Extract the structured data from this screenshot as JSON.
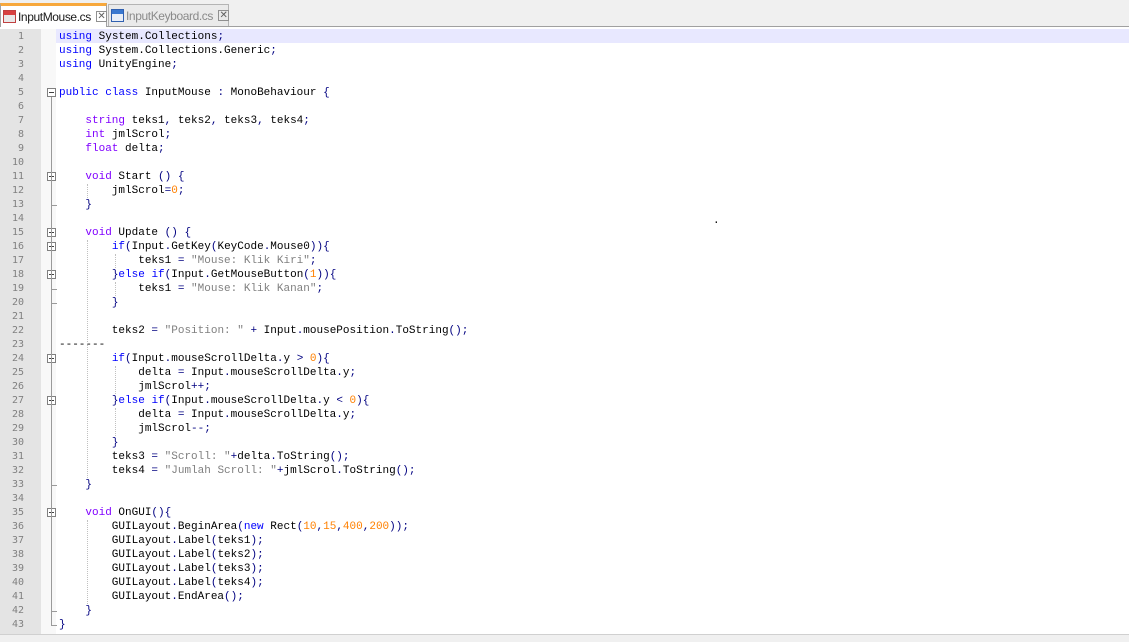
{
  "tabs": [
    {
      "label": "InputMouse.cs",
      "active": true,
      "icon": "file-modified-icon",
      "close_glyph": "✕"
    },
    {
      "label": "InputKeyboard.cs",
      "active": false,
      "icon": "file-saved-icon",
      "close_glyph": "✕"
    }
  ],
  "colors": {
    "keyword": "#0000ff",
    "type": "#8000ff",
    "string": "#808080",
    "number": "#ff8000",
    "operator": "#000080",
    "text": "#000000",
    "current_line": "#e8e8ff",
    "active_tab_accent": "#f7a83c"
  },
  "stray_text": ".",
  "code_lines": [
    [
      [
        "kw",
        "using"
      ],
      [
        "p",
        " System.Collections"
      ],
      [
        "op",
        ";"
      ]
    ],
    [
      [
        "kw",
        "using"
      ],
      [
        "p",
        " System.Collections.Generic"
      ],
      [
        "op",
        ";"
      ]
    ],
    [
      [
        "kw",
        "using"
      ],
      [
        "p",
        " UnityEngine"
      ],
      [
        "op",
        ";"
      ]
    ],
    [],
    [
      [
        "kw",
        "public"
      ],
      [
        "p",
        " "
      ],
      [
        "kw",
        "class"
      ],
      [
        "p",
        " InputMouse "
      ],
      [
        "op",
        ":"
      ],
      [
        "p",
        " MonoBehaviour "
      ],
      [
        "op",
        "{"
      ]
    ],
    [],
    [
      [
        "p",
        "    "
      ],
      [
        "ty",
        "string"
      ],
      [
        "p",
        " teks1"
      ],
      [
        "op",
        ","
      ],
      [
        "p",
        " teks2"
      ],
      [
        "op",
        ","
      ],
      [
        "p",
        " teks3"
      ],
      [
        "op",
        ","
      ],
      [
        "p",
        " teks4"
      ],
      [
        "op",
        ";"
      ]
    ],
    [
      [
        "p",
        "    "
      ],
      [
        "ty",
        "int"
      ],
      [
        "p",
        " jmlScrol"
      ],
      [
        "op",
        ";"
      ]
    ],
    [
      [
        "p",
        "    "
      ],
      [
        "ty",
        "float"
      ],
      [
        "p",
        " delta"
      ],
      [
        "op",
        ";"
      ]
    ],
    [],
    [
      [
        "p",
        "    "
      ],
      [
        "ty",
        "void"
      ],
      [
        "p",
        " Start "
      ],
      [
        "op",
        "()"
      ],
      [
        "p",
        " "
      ],
      [
        "op",
        "{"
      ]
    ],
    [
      [
        "p",
        "        jmlScrol"
      ],
      [
        "op",
        "="
      ],
      [
        "num",
        "0"
      ],
      [
        "op",
        ";"
      ]
    ],
    [
      [
        "p",
        "    "
      ],
      [
        "op",
        "}"
      ]
    ],
    [],
    [
      [
        "p",
        "    "
      ],
      [
        "ty",
        "void"
      ],
      [
        "p",
        " Update "
      ],
      [
        "op",
        "()"
      ],
      [
        "p",
        " "
      ],
      [
        "op",
        "{"
      ]
    ],
    [
      [
        "p",
        "        "
      ],
      [
        "kw",
        "if"
      ],
      [
        "op",
        "("
      ],
      [
        "p",
        "Input"
      ],
      [
        "op",
        "."
      ],
      [
        "p",
        "GetKey"
      ],
      [
        "op",
        "("
      ],
      [
        "p",
        "KeyCode"
      ],
      [
        "op",
        "."
      ],
      [
        "p",
        "Mouse0"
      ],
      [
        "op",
        ")){"
      ]
    ],
    [
      [
        "p",
        "            teks1 "
      ],
      [
        "op",
        "="
      ],
      [
        "p",
        " "
      ],
      [
        "str",
        "\"Mouse: Klik Kiri\""
      ],
      [
        "op",
        ";"
      ]
    ],
    [
      [
        "p",
        "        "
      ],
      [
        "op",
        "}"
      ],
      [
        "kw",
        "else"
      ],
      [
        "p",
        " "
      ],
      [
        "kw",
        "if"
      ],
      [
        "op",
        "("
      ],
      [
        "p",
        "Input"
      ],
      [
        "op",
        "."
      ],
      [
        "p",
        "GetMouseButton"
      ],
      [
        "op",
        "("
      ],
      [
        "num",
        "1"
      ],
      [
        "op",
        ")){"
      ]
    ],
    [
      [
        "p",
        "            teks1 "
      ],
      [
        "op",
        "="
      ],
      [
        "p",
        " "
      ],
      [
        "str",
        "\"Mouse: Klik Kanan\""
      ],
      [
        "op",
        ";"
      ]
    ],
    [
      [
        "p",
        "        "
      ],
      [
        "op",
        "}"
      ]
    ],
    [],
    [
      [
        "p",
        "        teks2 "
      ],
      [
        "op",
        "="
      ],
      [
        "p",
        " "
      ],
      [
        "str",
        "\"Position: \""
      ],
      [
        "p",
        " "
      ],
      [
        "op",
        "+"
      ],
      [
        "p",
        " Input"
      ],
      [
        "op",
        "."
      ],
      [
        "p",
        "mousePosition"
      ],
      [
        "op",
        "."
      ],
      [
        "p",
        "ToString"
      ],
      [
        "op",
        "();"
      ]
    ],
    [
      [
        "p",
        "-------"
      ]
    ],
    [
      [
        "p",
        "        "
      ],
      [
        "kw",
        "if"
      ],
      [
        "op",
        "("
      ],
      [
        "p",
        "Input"
      ],
      [
        "op",
        "."
      ],
      [
        "p",
        "mouseScrollDelta"
      ],
      [
        "op",
        "."
      ],
      [
        "p",
        "y "
      ],
      [
        "op",
        ">"
      ],
      [
        "p",
        " "
      ],
      [
        "num",
        "0"
      ],
      [
        "op",
        "){"
      ]
    ],
    [
      [
        "p",
        "            delta "
      ],
      [
        "op",
        "="
      ],
      [
        "p",
        " Input"
      ],
      [
        "op",
        "."
      ],
      [
        "p",
        "mouseScrollDelta"
      ],
      [
        "op",
        "."
      ],
      [
        "p",
        "y"
      ],
      [
        "op",
        ";"
      ]
    ],
    [
      [
        "p",
        "            jmlScrol"
      ],
      [
        "op",
        "++;"
      ]
    ],
    [
      [
        "p",
        "        "
      ],
      [
        "op",
        "}"
      ],
      [
        "kw",
        "else"
      ],
      [
        "p",
        " "
      ],
      [
        "kw",
        "if"
      ],
      [
        "op",
        "("
      ],
      [
        "p",
        "Input"
      ],
      [
        "op",
        "."
      ],
      [
        "p",
        "mouseScrollDelta"
      ],
      [
        "op",
        "."
      ],
      [
        "p",
        "y "
      ],
      [
        "op",
        "<"
      ],
      [
        "p",
        " "
      ],
      [
        "num",
        "0"
      ],
      [
        "op",
        "){"
      ]
    ],
    [
      [
        "p",
        "            delta "
      ],
      [
        "op",
        "="
      ],
      [
        "p",
        " Input"
      ],
      [
        "op",
        "."
      ],
      [
        "p",
        "mouseScrollDelta"
      ],
      [
        "op",
        "."
      ],
      [
        "p",
        "y"
      ],
      [
        "op",
        ";"
      ]
    ],
    [
      [
        "p",
        "            jmlScrol"
      ],
      [
        "op",
        "--;"
      ]
    ],
    [
      [
        "p",
        "        "
      ],
      [
        "op",
        "}"
      ]
    ],
    [
      [
        "p",
        "        teks3 "
      ],
      [
        "op",
        "="
      ],
      [
        "p",
        " "
      ],
      [
        "str",
        "\"Scroll: \""
      ],
      [
        "op",
        "+"
      ],
      [
        "p",
        "delta"
      ],
      [
        "op",
        "."
      ],
      [
        "p",
        "ToString"
      ],
      [
        "op",
        "();"
      ]
    ],
    [
      [
        "p",
        "        teks4 "
      ],
      [
        "op",
        "="
      ],
      [
        "p",
        " "
      ],
      [
        "str",
        "\"Jumlah Scroll: \""
      ],
      [
        "op",
        "+"
      ],
      [
        "p",
        "jmlScrol"
      ],
      [
        "op",
        "."
      ],
      [
        "p",
        "ToString"
      ],
      [
        "op",
        "();"
      ]
    ],
    [
      [
        "p",
        "    "
      ],
      [
        "op",
        "}"
      ]
    ],
    [],
    [
      [
        "p",
        "    "
      ],
      [
        "ty",
        "void"
      ],
      [
        "p",
        " OnGUI"
      ],
      [
        "op",
        "(){"
      ]
    ],
    [
      [
        "p",
        "        GUILayout"
      ],
      [
        "op",
        "."
      ],
      [
        "p",
        "BeginArea"
      ],
      [
        "op",
        "("
      ],
      [
        "kw",
        "new"
      ],
      [
        "p",
        " Rect"
      ],
      [
        "op",
        "("
      ],
      [
        "num",
        "10"
      ],
      [
        "op",
        ","
      ],
      [
        "num",
        "15"
      ],
      [
        "op",
        ","
      ],
      [
        "num",
        "400"
      ],
      [
        "op",
        ","
      ],
      [
        "num",
        "200"
      ],
      [
        "op",
        "));"
      ]
    ],
    [
      [
        "p",
        "        GUILayout"
      ],
      [
        "op",
        "."
      ],
      [
        "p",
        "Label"
      ],
      [
        "op",
        "("
      ],
      [
        "p",
        "teks1"
      ],
      [
        "op",
        ");"
      ]
    ],
    [
      [
        "p",
        "        GUILayout"
      ],
      [
        "op",
        "."
      ],
      [
        "p",
        "Label"
      ],
      [
        "op",
        "("
      ],
      [
        "p",
        "teks2"
      ],
      [
        "op",
        ");"
      ]
    ],
    [
      [
        "p",
        "        GUILayout"
      ],
      [
        "op",
        "."
      ],
      [
        "p",
        "Label"
      ],
      [
        "op",
        "("
      ],
      [
        "p",
        "teks3"
      ],
      [
        "op",
        ");"
      ]
    ],
    [
      [
        "p",
        "        GUILayout"
      ],
      [
        "op",
        "."
      ],
      [
        "p",
        "Label"
      ],
      [
        "op",
        "("
      ],
      [
        "p",
        "teks4"
      ],
      [
        "op",
        ");"
      ]
    ],
    [
      [
        "p",
        "        GUILayout"
      ],
      [
        "op",
        "."
      ],
      [
        "p",
        "EndArea"
      ],
      [
        "op",
        "();"
      ]
    ],
    [
      [
        "p",
        "    "
      ],
      [
        "op",
        "}"
      ]
    ],
    [
      [
        "op",
        "}"
      ]
    ]
  ]
}
